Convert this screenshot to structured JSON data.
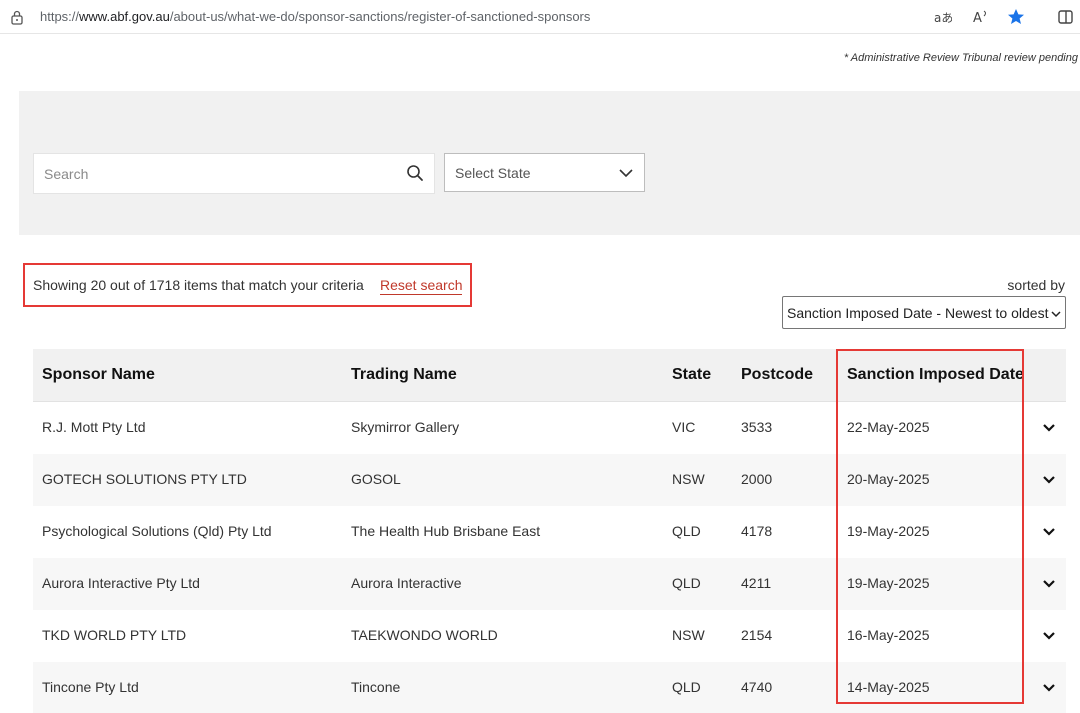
{
  "browser": {
    "url_prefix": "https://",
    "url_host": "www.abf.gov.au",
    "url_path": "/about-us/what-we-do/sponsor-sanctions/register-of-sanctioned-sponsors"
  },
  "note": "* Administrative Review Tribunal review pending",
  "filters": {
    "search_placeholder": "Search",
    "state_placeholder": "Select State"
  },
  "results": {
    "summary": "Showing 20 out of 1718 items that match your criteria",
    "reset_label": "Reset search",
    "sorted_by_label": "sorted by",
    "sort_value": "Sanction Imposed Date - Newest to oldest"
  },
  "table": {
    "headers": [
      "Sponsor Name",
      "Trading Name",
      "State",
      "Postcode",
      "Sanction Imposed Date"
    ],
    "rows": [
      {
        "sponsor": "R.J. Mott Pty Ltd",
        "trading": "Skymirror Gallery",
        "state": "VIC",
        "postcode": "3533",
        "date": "22-May-2025"
      },
      {
        "sponsor": "GOTECH SOLUTIONS PTY LTD",
        "trading": "GOSOL",
        "state": "NSW",
        "postcode": "2000",
        "date": "20-May-2025"
      },
      {
        "sponsor": "Psychological Solutions (Qld) Pty Ltd",
        "trading": "The Health Hub Brisbane East",
        "state": "QLD",
        "postcode": "4178",
        "date": "19-May-2025"
      },
      {
        "sponsor": "Aurora Interactive Pty Ltd",
        "trading": "Aurora Interactive",
        "state": "QLD",
        "postcode": "4211",
        "date": "19-May-2025"
      },
      {
        "sponsor": "TKD WORLD PTY LTD",
        "trading": "TAEKWONDO WORLD",
        "state": "NSW",
        "postcode": "2154",
        "date": "16-May-2025"
      },
      {
        "sponsor": "Tincone Pty Ltd",
        "trading": "Tincone",
        "state": "QLD",
        "postcode": "4740",
        "date": "14-May-2025"
      }
    ]
  },
  "colors": {
    "highlight": "#e53935",
    "reset_link": "#c0392b",
    "panel_bg": "#f1f1f1",
    "favorite_star": "#1a73e8"
  },
  "icons": [
    "lock-icon",
    "read-aloud-icon",
    "text-size-icon",
    "favorite-star-icon",
    "split-screen-icon",
    "search-icon",
    "chevron-down-icon"
  ]
}
